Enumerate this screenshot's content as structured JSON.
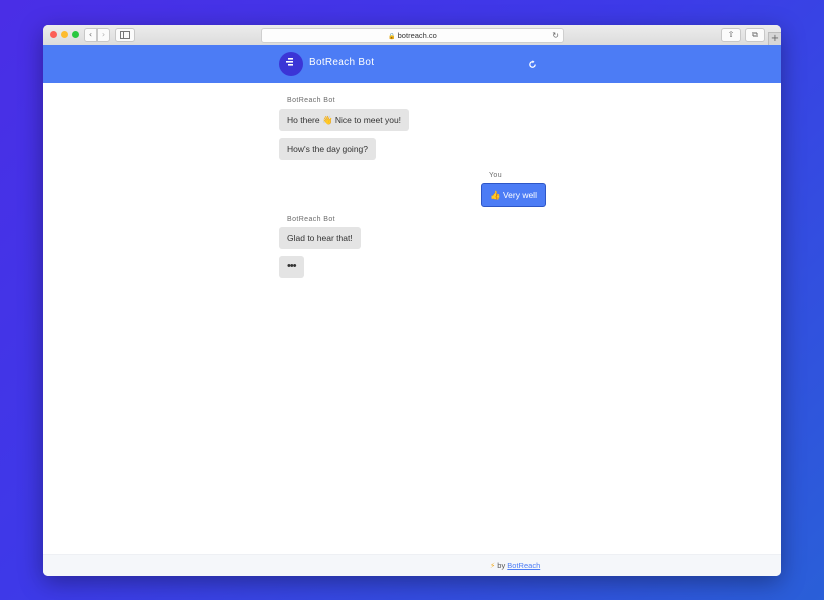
{
  "browser": {
    "url": "botreach.co"
  },
  "header": {
    "title": "BotReach Bot",
    "logo_text": "BOTREACH",
    "accent_color": "#4c7cf5"
  },
  "messages": [
    {
      "sender": "BotReach Bot",
      "text": "Ho there 👋 Nice to meet you!"
    },
    {
      "text": "How's the day going?"
    },
    {
      "sender": "You",
      "text": "👍 Very well"
    },
    {
      "sender": "BotReach Bot",
      "text": "Glad to hear that!"
    },
    {
      "text": "•••"
    }
  ],
  "footer": {
    "by_text": "by",
    "link_text": "BotReach"
  }
}
